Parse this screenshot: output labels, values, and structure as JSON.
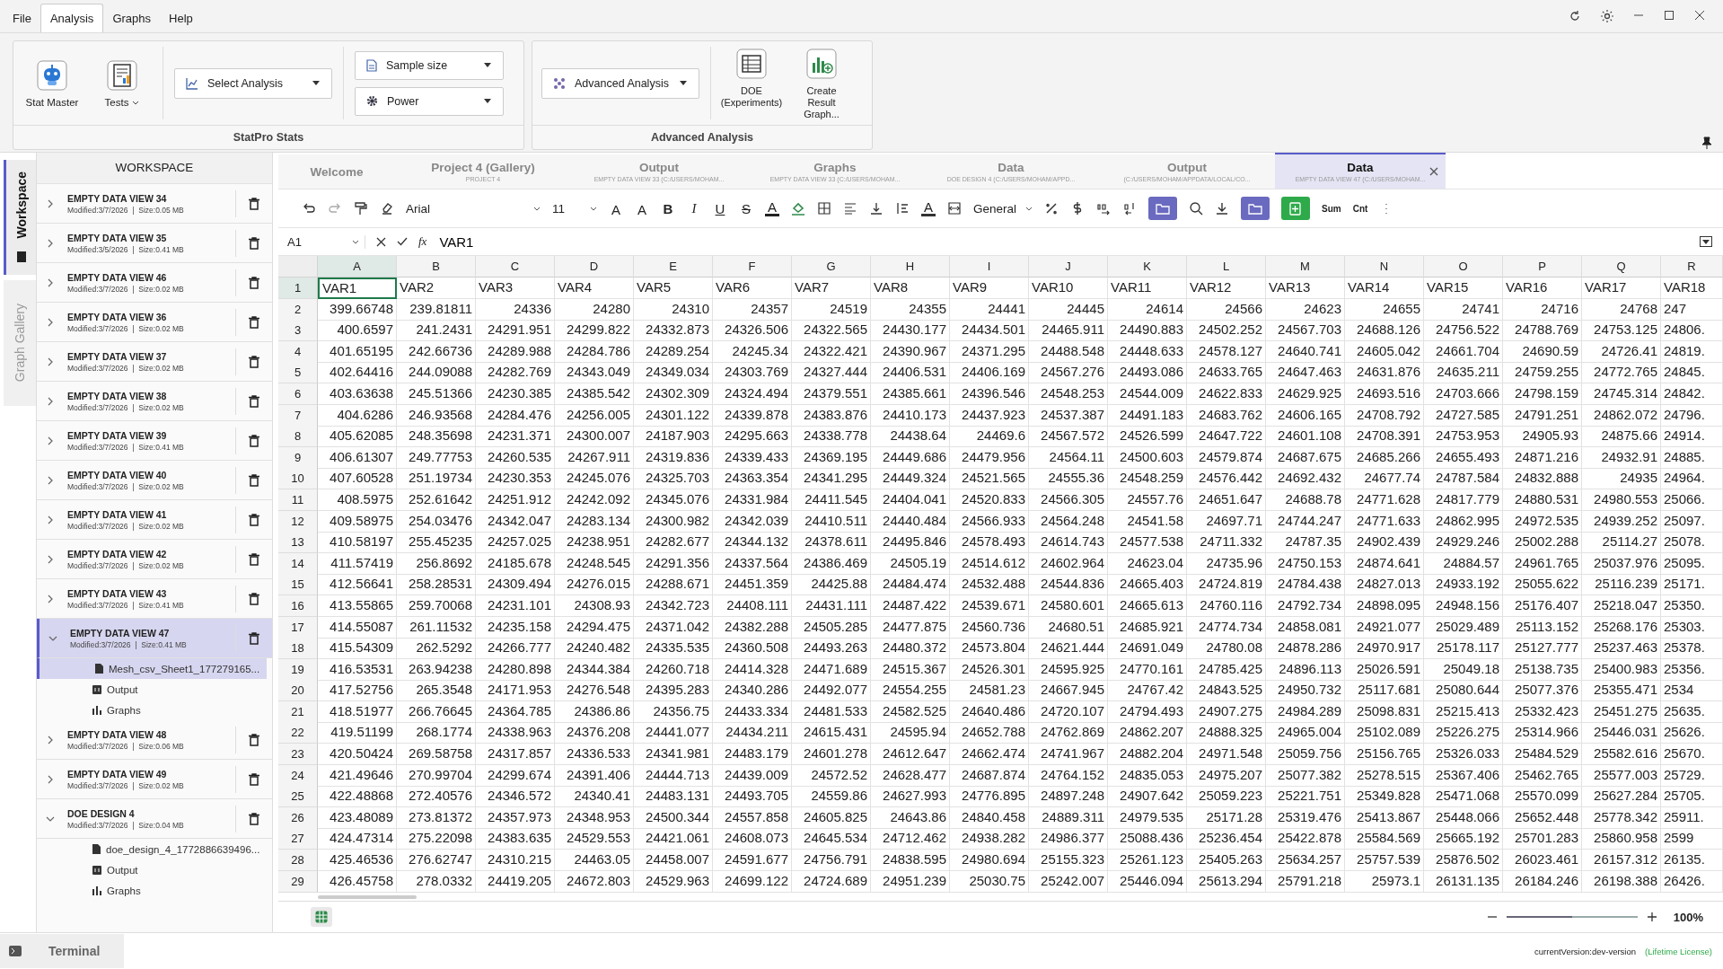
{
  "menu": [
    {
      "label": "File",
      "selected": false
    },
    {
      "label": "Analysis",
      "selected": true
    },
    {
      "label": "Graphs",
      "selected": false
    },
    {
      "label": "Help",
      "selected": false
    }
  ],
  "ribbon": {
    "groups": [
      {
        "title": "StatPro Stats",
        "kind": "stats",
        "big_buttons": [
          {
            "label": "Stat Master",
            "kind": "robot",
            "caret": false
          },
          {
            "label": "Tests",
            "kind": "report",
            "caret": true
          }
        ],
        "dropdowns": [
          {
            "label": "Select Analysis",
            "kind": "chart"
          },
          {
            "label": "Sample size",
            "kind": "doc"
          },
          {
            "label": "Power",
            "kind": "gear"
          }
        ]
      },
      {
        "title": "Advanced Analysis",
        "kind": "advanced",
        "big_buttons": [
          {
            "label": "DOE (Experiments)",
            "kind": "table",
            "caret": false
          },
          {
            "label": "Create Result Graph...",
            "kind": "graphplus",
            "caret": false
          }
        ],
        "dropdowns": [
          {
            "label": "Advanced Analysis",
            "kind": "network"
          }
        ]
      }
    ]
  },
  "side_tabs": [
    {
      "label": "Workspace",
      "selected": true
    },
    {
      "label": "Graph Gallery",
      "selected": false
    }
  ],
  "workspace": {
    "title": "WORKSPACE",
    "items": [
      {
        "name": "EMPTY DATA VIEW 34",
        "meta": "Modified:3/7/2026  |  Size:0.05 MB",
        "expanded": false,
        "selected": false
      },
      {
        "name": "EMPTY DATA VIEW 35",
        "meta": "Modified:3/5/2026  |  Size:0.41 MB",
        "expanded": false,
        "selected": false
      },
      {
        "name": "EMPTY DATA VIEW 46",
        "meta": "Modified:3/7/2026  |  Size:0.02 MB",
        "expanded": false,
        "selected": false
      },
      {
        "name": "EMPTY DATA VIEW 36",
        "meta": "Modified:3/7/2026  |  Size:0.02 MB",
        "expanded": false,
        "selected": false
      },
      {
        "name": "EMPTY DATA VIEW 37",
        "meta": "Modified:3/7/2026  |  Size:0.02 MB",
        "expanded": false,
        "selected": false
      },
      {
        "name": "EMPTY DATA VIEW 38",
        "meta": "Modified:3/7/2026  |  Size:0.02 MB",
        "expanded": false,
        "selected": false
      },
      {
        "name": "EMPTY DATA VIEW 39",
        "meta": "Modified:3/7/2026  |  Size:0.41 MB",
        "expanded": false,
        "selected": false
      },
      {
        "name": "EMPTY DATA VIEW 40",
        "meta": "Modified:3/7/2026  |  Size:0.02 MB",
        "expanded": false,
        "selected": false
      },
      {
        "name": "EMPTY DATA VIEW 41",
        "meta": "Modified:3/7/2026  |  Size:0.02 MB",
        "expanded": false,
        "selected": false
      },
      {
        "name": "EMPTY DATA VIEW 42",
        "meta": "Modified:3/7/2026  |  Size:0.02 MB",
        "expanded": false,
        "selected": false
      },
      {
        "name": "EMPTY DATA VIEW 43",
        "meta": "Modified:3/7/2026  |  Size:0.41 MB",
        "expanded": false,
        "selected": false
      },
      {
        "name": "EMPTY DATA VIEW 47",
        "meta": "Modified:3/7/2026  |  Size:0.41 MB",
        "expanded": true,
        "selected": true,
        "children": [
          {
            "label": "Mesh_csv_Sheet1_177279165...",
            "kind": "file",
            "selected": true
          },
          {
            "label": "Output",
            "kind": "output",
            "selected": false
          },
          {
            "label": "Graphs",
            "kind": "graphs",
            "selected": false
          }
        ]
      },
      {
        "name": "EMPTY DATA VIEW 48",
        "meta": "Modified:3/7/2026  |  Size:0.06 MB",
        "expanded": false,
        "selected": false
      },
      {
        "name": "EMPTY DATA VIEW 49",
        "meta": "Modified:3/7/2026  |  Size:0.02 MB",
        "expanded": false,
        "selected": false
      },
      {
        "name": "DOE DESIGN 4",
        "meta": "Modified:3/7/2026  |  Size:0.04 MB",
        "expanded": true,
        "selected": false,
        "children": [
          {
            "label": "doe_design_4_1772886639496...",
            "kind": "file",
            "selected": false
          },
          {
            "label": "Output",
            "kind": "output",
            "selected": false
          },
          {
            "label": "Graphs",
            "kind": "graphs",
            "selected": false
          }
        ]
      }
    ]
  },
  "doc_tabs": [
    {
      "title": "Welcome",
      "selected": false
    },
    {
      "title": "Project 4 (Gallery)",
      "subtitle": "PROJECT 4",
      "selected": false
    },
    {
      "title": "Output",
      "subtitle": "EMPTY DATA VIEW 33 (C:/USERS/MOHAM...",
      "selected": false
    },
    {
      "title": "Graphs",
      "subtitle": "EMPTY DATA VIEW 33 (C:/USERS/MOHAM...",
      "selected": false
    },
    {
      "title": "Data",
      "subtitle": "DOE DESIGN 4 (C:/USERS/MOHAM/APPD...",
      "selected": false
    },
    {
      "title": "Output",
      "subtitle": "(C:/USERS/MOHAM/APPDATA/LOCAL/CO...",
      "selected": false
    },
    {
      "title": "Data",
      "subtitle": "EMPTY DATA VIEW 47 (C:/USERS/MOHAM...",
      "selected": true
    }
  ],
  "toolbar": [
    {
      "kind": "undo"
    },
    {
      "kind": "redo"
    },
    {
      "kind": "painter"
    },
    {
      "kind": "eraser"
    },
    {
      "kind": "select",
      "text": "Arial",
      "wide": true
    },
    {
      "kind": "select",
      "text": "11",
      "wide": false
    },
    {
      "kind": "grow",
      "text": "A"
    },
    {
      "kind": "shrink",
      "text": "A"
    },
    {
      "kind": "bold",
      "text": "B"
    },
    {
      "kind": "italic",
      "text": "I"
    },
    {
      "kind": "underline",
      "text": "U"
    },
    {
      "kind": "strike",
      "text": "S"
    },
    {
      "kind": "fontcolor",
      "text": "A"
    },
    {
      "kind": "fill"
    },
    {
      "kind": "borders"
    },
    {
      "kind": "align"
    },
    {
      "kind": "valign"
    },
    {
      "kind": "wrap"
    },
    {
      "kind": "textcolor",
      "text": "A"
    },
    {
      "kind": "merge"
    },
    {
      "kind": "select",
      "text": "General",
      "wide": false
    },
    {
      "kind": "percent"
    },
    {
      "kind": "dollar"
    },
    {
      "kind": "decup"
    },
    {
      "kind": "decdown"
    },
    {
      "kind": "folderbtn"
    },
    {
      "kind": "search"
    },
    {
      "kind": "download"
    },
    {
      "kind": "folderbtn"
    },
    {
      "kind": "addbtn"
    },
    {
      "kind": "label",
      "text": "Sum"
    },
    {
      "kind": "label",
      "text": "Cnt"
    },
    {
      "kind": "more"
    }
  ],
  "formula_bar": {
    "cell": "A1",
    "fx": "fx",
    "value": "VAR1"
  },
  "grid": {
    "columns": [
      {
        "label": "A",
        "selected": true
      },
      {
        "label": "B",
        "selected": false
      },
      {
        "label": "C",
        "selected": false
      },
      {
        "label": "D",
        "selected": false
      },
      {
        "label": "E",
        "selected": false
      },
      {
        "label": "F",
        "selected": false
      },
      {
        "label": "G",
        "selected": false
      },
      {
        "label": "H",
        "selected": false
      },
      {
        "label": "I",
        "selected": false
      },
      {
        "label": "J",
        "selected": false
      },
      {
        "label": "K",
        "selected": false
      },
      {
        "label": "L",
        "selected": false
      },
      {
        "label": "M",
        "selected": false
      },
      {
        "label": "N",
        "selected": false
      },
      {
        "label": "O",
        "selected": false
      },
      {
        "label": "P",
        "selected": false
      },
      {
        "label": "Q",
        "selected": false
      },
      {
        "label": "R",
        "selected": false
      }
    ],
    "rows": [
      {
        "label": "1",
        "selected": true,
        "kind": "names",
        "cells": [
          "VAR1",
          "VAR2",
          "VAR3",
          "VAR4",
          "VAR5",
          "VAR6",
          "VAR7",
          "VAR8",
          "VAR9",
          "VAR10",
          "VAR11",
          "VAR12",
          "VAR13",
          "VAR14",
          "VAR15",
          "VAR16",
          "VAR17",
          "VAR18"
        ]
      },
      {
        "label": "2",
        "selected": false,
        "kind": "values",
        "cells": [
          "399.66748",
          "239.81811",
          "24336",
          "24280",
          "24310",
          "24357",
          "24519",
          "24355",
          "24441",
          "24445",
          "24614",
          "24566",
          "24623",
          "24655",
          "24741",
          "24716",
          "24768",
          "247"
        ]
      },
      {
        "label": "3",
        "selected": false,
        "kind": "values",
        "cells": [
          "400.6597",
          "241.2431",
          "24291.951",
          "24299.822",
          "24332.873",
          "24326.506",
          "24322.565",
          "24430.177",
          "24434.501",
          "24465.911",
          "24490.883",
          "24502.252",
          "24567.703",
          "24688.126",
          "24756.522",
          "24788.769",
          "24753.125",
          "24806."
        ]
      },
      {
        "label": "4",
        "selected": false,
        "kind": "values",
        "cells": [
          "401.65195",
          "242.66736",
          "24289.988",
          "24284.786",
          "24289.254",
          "24245.34",
          "24322.421",
          "24390.967",
          "24371.295",
          "24488.548",
          "24448.633",
          "24578.127",
          "24640.741",
          "24605.042",
          "24661.704",
          "24690.59",
          "24726.41",
          "24819."
        ]
      },
      {
        "label": "5",
        "selected": false,
        "kind": "values",
        "cells": [
          "402.64416",
          "244.09088",
          "24282.769",
          "24343.049",
          "24349.034",
          "24303.769",
          "24327.444",
          "24406.531",
          "24406.169",
          "24567.276",
          "24493.086",
          "24633.765",
          "24647.463",
          "24631.876",
          "24635.211",
          "24759.255",
          "24772.765",
          "24845."
        ]
      },
      {
        "label": "6",
        "selected": false,
        "kind": "values",
        "cells": [
          "403.63638",
          "245.51366",
          "24230.385",
          "24385.542",
          "24302.309",
          "24324.494",
          "24379.551",
          "24385.661",
          "24396.546",
          "24548.253",
          "24544.009",
          "24622.833",
          "24629.925",
          "24693.516",
          "24703.666",
          "24798.159",
          "24745.314",
          "24842."
        ]
      },
      {
        "label": "7",
        "selected": false,
        "kind": "values",
        "cells": [
          "404.6286",
          "246.93568",
          "24284.476",
          "24256.005",
          "24301.122",
          "24339.878",
          "24383.876",
          "24410.173",
          "24437.923",
          "24537.387",
          "24491.183",
          "24683.762",
          "24606.165",
          "24708.792",
          "24727.585",
          "24791.251",
          "24862.072",
          "24796."
        ]
      },
      {
        "label": "8",
        "selected": false,
        "kind": "values",
        "cells": [
          "405.62085",
          "248.35698",
          "24231.371",
          "24300.007",
          "24187.903",
          "24295.663",
          "24338.778",
          "24438.64",
          "24469.6",
          "24567.572",
          "24526.599",
          "24647.722",
          "24601.108",
          "24708.391",
          "24753.953",
          "24905.93",
          "24875.66",
          "24914."
        ]
      },
      {
        "label": "9",
        "selected": false,
        "kind": "values",
        "cells": [
          "406.61307",
          "249.77753",
          "24260.535",
          "24267.911",
          "24319.836",
          "24339.433",
          "24369.195",
          "24449.686",
          "24479.956",
          "24564.11",
          "24500.603",
          "24579.874",
          "24687.675",
          "24685.266",
          "24655.493",
          "24871.216",
          "24932.91",
          "24885."
        ]
      },
      {
        "label": "10",
        "selected": false,
        "kind": "values",
        "cells": [
          "407.60528",
          "251.19734",
          "24230.353",
          "24245.076",
          "24325.703",
          "24363.354",
          "24341.295",
          "24449.324",
          "24521.565",
          "24555.36",
          "24548.259",
          "24576.442",
          "24692.432",
          "24677.74",
          "24787.584",
          "24832.888",
          "24935",
          "24964."
        ]
      },
      {
        "label": "11",
        "selected": false,
        "kind": "values",
        "cells": [
          "408.5975",
          "252.61642",
          "24251.912",
          "24242.092",
          "24345.076",
          "24331.984",
          "24411.545",
          "24404.041",
          "24520.833",
          "24566.305",
          "24557.76",
          "24651.647",
          "24688.78",
          "24771.628",
          "24817.779",
          "24880.531",
          "24980.553",
          "25066."
        ]
      },
      {
        "label": "12",
        "selected": false,
        "kind": "values",
        "cells": [
          "409.58975",
          "254.03476",
          "24342.047",
          "24283.134",
          "24300.982",
          "24342.039",
          "24410.511",
          "24440.484",
          "24566.933",
          "24564.248",
          "24541.58",
          "24697.71",
          "24744.247",
          "24771.633",
          "24862.995",
          "24972.535",
          "24939.252",
          "25097."
        ]
      },
      {
        "label": "13",
        "selected": false,
        "kind": "values",
        "cells": [
          "410.58197",
          "255.45235",
          "24257.025",
          "24238.951",
          "24282.677",
          "24344.132",
          "24378.611",
          "24495.846",
          "24578.493",
          "24614.743",
          "24577.538",
          "24711.332",
          "24787.35",
          "24902.439",
          "24929.246",
          "25002.288",
          "25114.27",
          "25078."
        ]
      },
      {
        "label": "14",
        "selected": false,
        "kind": "values",
        "cells": [
          "411.57419",
          "256.8692",
          "24185.678",
          "24248.545",
          "24291.356",
          "24337.564",
          "24386.469",
          "24505.19",
          "24514.612",
          "24602.964",
          "24623.04",
          "24735.96",
          "24750.153",
          "24874.641",
          "24884.57",
          "24961.765",
          "25037.976",
          "25095."
        ]
      },
      {
        "label": "15",
        "selected": false,
        "kind": "values",
        "cells": [
          "412.56641",
          "258.28531",
          "24309.494",
          "24276.015",
          "24288.671",
          "24451.359",
          "24425.88",
          "24484.474",
          "24532.488",
          "24544.836",
          "24665.403",
          "24724.819",
          "24784.438",
          "24827.013",
          "24933.192",
          "25055.622",
          "25116.239",
          "25171."
        ]
      },
      {
        "label": "16",
        "selected": false,
        "kind": "values",
        "cells": [
          "413.55865",
          "259.70068",
          "24231.101",
          "24308.93",
          "24342.723",
          "24408.111",
          "24431.111",
          "24487.422",
          "24539.671",
          "24580.601",
          "24665.613",
          "24760.116",
          "24792.734",
          "24898.095",
          "24948.156",
          "25176.407",
          "25218.047",
          "25350."
        ]
      },
      {
        "label": "17",
        "selected": false,
        "kind": "values",
        "cells": [
          "414.55087",
          "261.11532",
          "24235.158",
          "24294.475",
          "24371.042",
          "24382.288",
          "24505.285",
          "24477.875",
          "24560.736",
          "24680.51",
          "24685.921",
          "24774.734",
          "24858.081",
          "24921.077",
          "25029.489",
          "25113.152",
          "25268.176",
          "25303."
        ]
      },
      {
        "label": "18",
        "selected": false,
        "kind": "values",
        "cells": [
          "415.54309",
          "262.5292",
          "24266.777",
          "24240.482",
          "24335.535",
          "24360.508",
          "24493.263",
          "24480.372",
          "24573.804",
          "24621.444",
          "24691.049",
          "24780.08",
          "24878.286",
          "24970.917",
          "25178.117",
          "25127.777",
          "25237.463",
          "25378."
        ]
      },
      {
        "label": "19",
        "selected": false,
        "kind": "values",
        "cells": [
          "416.53531",
          "263.94238",
          "24280.898",
          "24344.384",
          "24260.718",
          "24414.328",
          "24471.689",
          "24515.367",
          "24526.301",
          "24595.925",
          "24770.161",
          "24785.425",
          "24896.113",
          "25026.591",
          "25049.18",
          "25138.735",
          "25400.983",
          "25356."
        ]
      },
      {
        "label": "20",
        "selected": false,
        "kind": "values",
        "cells": [
          "417.52756",
          "265.3548",
          "24171.953",
          "24276.548",
          "24395.283",
          "24340.286",
          "24492.077",
          "24554.255",
          "24581.23",
          "24667.945",
          "24767.42",
          "24843.525",
          "24950.732",
          "25117.681",
          "25080.644",
          "25077.376",
          "25355.471",
          "2534"
        ]
      },
      {
        "label": "21",
        "selected": false,
        "kind": "values",
        "cells": [
          "418.51977",
          "266.76645",
          "24364.785",
          "24386.86",
          "24356.75",
          "24433.334",
          "24481.533",
          "24582.525",
          "24640.486",
          "24720.107",
          "24794.493",
          "24907.275",
          "24984.289",
          "25098.831",
          "25215.413",
          "25332.423",
          "25451.275",
          "25635."
        ]
      },
      {
        "label": "22",
        "selected": false,
        "kind": "values",
        "cells": [
          "419.51199",
          "268.1774",
          "24338.963",
          "24376.208",
          "24441.077",
          "24434.211",
          "24615.431",
          "24595.94",
          "24652.788",
          "24762.869",
          "24862.207",
          "24888.325",
          "24965.004",
          "25102.089",
          "25226.275",
          "25314.966",
          "25446.031",
          "25626."
        ]
      },
      {
        "label": "23",
        "selected": false,
        "kind": "values",
        "cells": [
          "420.50424",
          "269.58758",
          "24317.857",
          "24336.533",
          "24341.981",
          "24483.179",
          "24601.278",
          "24612.647",
          "24662.474",
          "24741.967",
          "24882.204",
          "24971.548",
          "25059.756",
          "25156.765",
          "25326.033",
          "25484.529",
          "25582.616",
          "25670."
        ]
      },
      {
        "label": "24",
        "selected": false,
        "kind": "values",
        "cells": [
          "421.49646",
          "270.99704",
          "24299.674",
          "24391.406",
          "24444.713",
          "24439.009",
          "24572.52",
          "24628.477",
          "24687.874",
          "24764.152",
          "24835.053",
          "24975.207",
          "25077.382",
          "25278.515",
          "25367.406",
          "25462.765",
          "25577.003",
          "25729."
        ]
      },
      {
        "label": "25",
        "selected": false,
        "kind": "values",
        "cells": [
          "422.48868",
          "272.40576",
          "24346.572",
          "24340.41",
          "24483.131",
          "24493.705",
          "24559.86",
          "24627.993",
          "24776.895",
          "24897.248",
          "24907.642",
          "25059.223",
          "25221.751",
          "25349.828",
          "25471.068",
          "25570.099",
          "25627.284",
          "25705."
        ]
      },
      {
        "label": "26",
        "selected": false,
        "kind": "values",
        "cells": [
          "423.48089",
          "273.81372",
          "24357.973",
          "24348.953",
          "24500.344",
          "24557.858",
          "24605.825",
          "24643.86",
          "24840.458",
          "24889.311",
          "24979.535",
          "25171.28",
          "25319.476",
          "25413.867",
          "25448.066",
          "25652.448",
          "25778.342",
          "25911."
        ]
      },
      {
        "label": "27",
        "selected": false,
        "kind": "values",
        "cells": [
          "424.47314",
          "275.22098",
          "24383.635",
          "24529.553",
          "24421.061",
          "24608.073",
          "24645.534",
          "24712.462",
          "24938.282",
          "24986.377",
          "25088.436",
          "25236.454",
          "25422.878",
          "25584.569",
          "25665.192",
          "25701.283",
          "25860.958",
          "2599"
        ]
      },
      {
        "label": "28",
        "selected": false,
        "kind": "values",
        "cells": [
          "425.46536",
          "276.62747",
          "24310.215",
          "24463.05",
          "24458.007",
          "24591.677",
          "24756.791",
          "24838.595",
          "24980.694",
          "25155.323",
          "25261.123",
          "25405.263",
          "25634.257",
          "25757.539",
          "25876.502",
          "26023.461",
          "26157.312",
          "26135."
        ]
      },
      {
        "label": "29",
        "selected": false,
        "kind": "values",
        "cells": [
          "426.45758",
          "278.0332",
          "24419.205",
          "24672.803",
          "24529.963",
          "24699.122",
          "24724.689",
          "24951.239",
          "25030.75",
          "25242.007",
          "25446.094",
          "25613.294",
          "25791.218",
          "25973.1",
          "26131.135",
          "26184.246",
          "26198.388",
          "26426."
        ]
      }
    ]
  },
  "zoom": {
    "level": 0.5,
    "value": "100%"
  },
  "status": {
    "terminal": "Terminal",
    "version": "currentVersion:dev-version",
    "license": "(Lifetime License)"
  }
}
